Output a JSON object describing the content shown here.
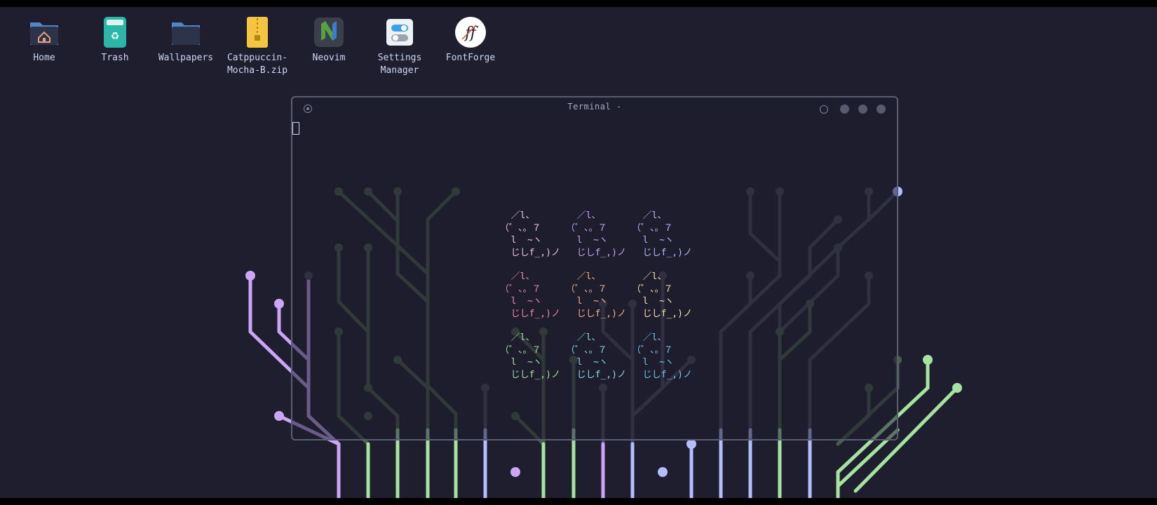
{
  "desktop": {
    "background": "#1e1e2e",
    "icons": [
      {
        "label": "Home",
        "icon": "home-folder-icon"
      },
      {
        "label": "Trash",
        "icon": "trash-icon"
      },
      {
        "label": "Wallpapers",
        "icon": "folder-icon"
      },
      {
        "label": "Catppuccin-\nMocha-B.zip",
        "icon": "zip-archive-icon"
      },
      {
        "label": "Neovim",
        "icon": "neovim-icon"
      },
      {
        "label": "Settings\nManager",
        "icon": "settings-manager-icon"
      },
      {
        "label": "FontForge",
        "icon": "fontforge-icon"
      }
    ]
  },
  "terminal": {
    "title": "Terminal -",
    "colors": {
      "border": "#5b5e72",
      "text": "#cdd6f4"
    },
    "cat_art": [
      "  ／l、",
      "（゜、。７",
      "  l  ~ヽ",
      "  じしf_,)ノ"
    ],
    "cat_colors": [
      [
        "#f5c2e7",
        "#cba6f7",
        "#b4befe"
      ],
      [
        "#f38ba8",
        "#fab387",
        "#f9e2af"
      ],
      [
        "#a6e3a1",
        "#89dceb",
        "#74c7ec"
      ]
    ]
  },
  "wallpaper": {
    "palette": {
      "purple": "#cba6f7",
      "green": "#a6e3a1",
      "blue": "#b4befe",
      "dim_green": "#4a5e4c",
      "dim_blue": "#45475a"
    }
  }
}
